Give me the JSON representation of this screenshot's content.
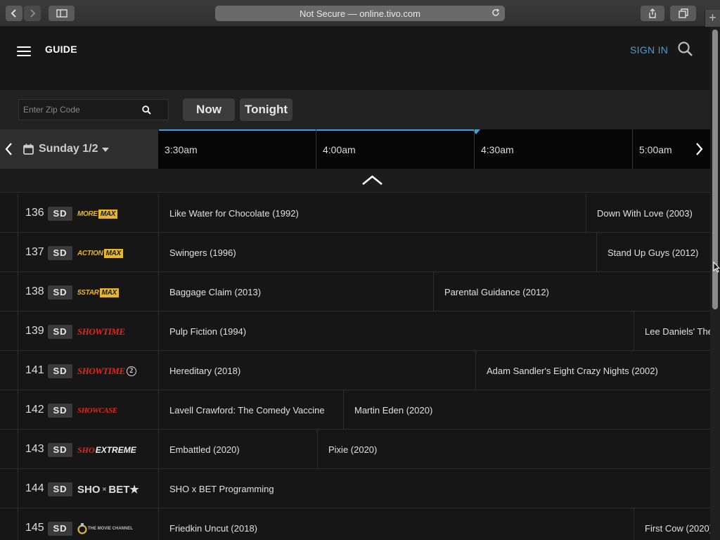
{
  "browser": {
    "address": "Not Secure — online.tivo.com",
    "newtab": "+"
  },
  "header": {
    "title": "GUIDE",
    "signin": "SIGN IN"
  },
  "controls": {
    "zip_placeholder": "Enter Zip Code",
    "now": "Now",
    "tonight": "Tonight"
  },
  "timebar": {
    "day": "Sunday 1/2",
    "slots": [
      "3:30am",
      "4:00am",
      "4:30am",
      "5:00am"
    ]
  },
  "channels": [
    {
      "number": "136",
      "quality": "SD",
      "logo_icon": "moremax-logo-icon",
      "logo_text": "MORE",
      "logo_box": "MAX",
      "programs": [
        "Like Water for Chocolate (1992)",
        "Down With Love (2003)"
      ]
    },
    {
      "number": "137",
      "quality": "SD",
      "logo_icon": "actionmax-logo-icon",
      "logo_text": "ACTION",
      "logo_box": "MAX",
      "programs": [
        "Swingers (1996)",
        "Stand Up Guys (2012)"
      ]
    },
    {
      "number": "138",
      "quality": "SD",
      "logo_icon": "5starmax-logo-icon",
      "logo_text": "5STAR",
      "logo_box": "MAX",
      "programs": [
        "Baggage Claim (2013)",
        "Parental Guidance (2012)"
      ]
    },
    {
      "number": "139",
      "quality": "SD",
      "logo_icon": "showtime-logo-icon",
      "logo_text": "SHOWTIME",
      "programs": [
        "Pulp Fiction (1994)",
        "Lee Daniels' The"
      ]
    },
    {
      "number": "141",
      "quality": "SD",
      "logo_icon": "showtime2-logo-icon",
      "logo_text": "SHOWTIME",
      "logo_badge": "2",
      "programs": [
        "Hereditary (2018)",
        "Adam Sandler's Eight Crazy Nights (2002)"
      ]
    },
    {
      "number": "142",
      "quality": "SD",
      "logo_icon": "showcase-logo-icon",
      "logo_text": "SHOWCASE",
      "programs": [
        "Lavell Crawford: The Comedy Vaccine",
        "Martin Eden (2020)"
      ]
    },
    {
      "number": "143",
      "quality": "SD",
      "logo_icon": "sho-extreme-logo-icon",
      "logo_text": "SHO",
      "logo_text2": "EXTREME",
      "programs": [
        "Embattled (2020)",
        "Pixie (2020)"
      ]
    },
    {
      "number": "144",
      "quality": "SD",
      "logo_icon": "sho-x-bet-logo-icon",
      "logo_text": "SHO",
      "logo_sep": "×",
      "logo_text2": "BET★",
      "programs": [
        "SHO x BET Programming"
      ]
    },
    {
      "number": "145",
      "quality": "SD",
      "logo_icon": "the-movie-channel-logo-icon",
      "logo_text": "THE MOVIE CHANNEL",
      "programs": [
        "Friedkin Uncut (2018)",
        "First Cow (2020)"
      ]
    }
  ],
  "colors": {
    "accent": "#3fa2dd",
    "max_gold": "#e6b62b",
    "showtime_red": "#e2261c"
  }
}
